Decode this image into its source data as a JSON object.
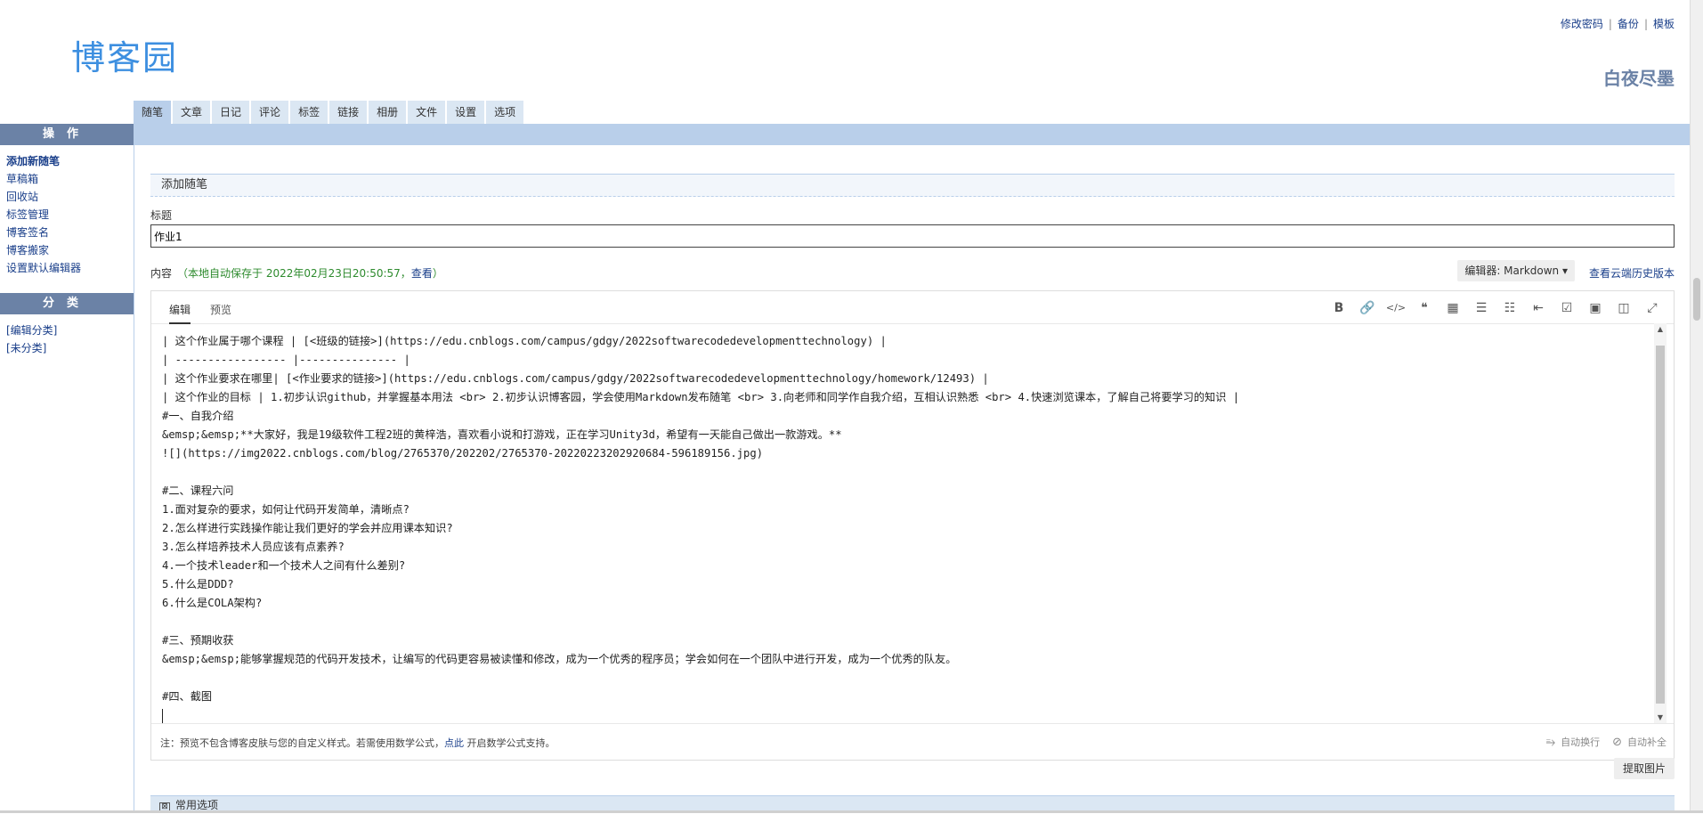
{
  "header": {
    "logo": "博客园",
    "links": [
      "修改密码",
      "备份",
      "模板"
    ],
    "user_name": "白夜尽墨"
  },
  "tabs": [
    {
      "label": "随笔",
      "active": true
    },
    {
      "label": "文章"
    },
    {
      "label": "日记"
    },
    {
      "label": "评论"
    },
    {
      "label": "标签"
    },
    {
      "label": "链接"
    },
    {
      "label": "相册"
    },
    {
      "label": "文件"
    },
    {
      "label": "设置"
    },
    {
      "label": "选项"
    }
  ],
  "sidebar": {
    "ops_title": "操作",
    "ops_items": [
      "添加新随笔",
      "草稿箱",
      "回收站",
      "标签管理",
      "博客签名",
      "博客搬家",
      "设置默认编辑器"
    ],
    "cat_title": "分类",
    "cat_items": [
      "[编辑分类]",
      "[未分类]"
    ]
  },
  "main": {
    "section_title": "添加随笔",
    "title_label": "标题",
    "title_value": "作业1",
    "content_label": "内容",
    "autosave_text": "（本地自动保存于 2022年02月23日20:50:57，",
    "autosave_link": "查看",
    "autosave_end": "）",
    "editor_select": "编辑器: Markdown ▾",
    "history_link": "查看云端历史版本",
    "editor_tabs": [
      "编辑",
      "预览"
    ],
    "toolbar_icons": [
      "B",
      "🔗",
      "</>",
      "❝",
      "▦",
      "☰",
      "☷",
      "⇤",
      "☑",
      "▣",
      "◫",
      "⤢"
    ],
    "code_lines": [
      "| 这个作业属于哪个课程 | [<班级的链接>](https://edu.cnblogs.com/campus/gdgy/2022softwarecodedevelopmenttechnology) |",
      "| ----------------- |--------------- |",
      "| 这个作业要求在哪里| [<作业要求的链接>](https://edu.cnblogs.com/campus/gdgy/2022softwarecodedevelopmenttechnology/homework/12493) |",
      "| 这个作业的目标 | 1.初步认识github，并掌握基本用法 <br> 2.初步认识博客园，学会使用Markdown发布随笔 <br> 3.向老师和同学作自我介绍，互相认识熟悉 <br> 4.快速浏览课本，了解自己将要学习的知识 |",
      "#一、自我介绍",
      "&emsp;&emsp;**大家好，我是19级软件工程2班的黄梓浩，喜欢看小说和打游戏，正在学习Unity3d，希望有一天能自己做出一款游戏。**",
      "![](https://img2022.cnblogs.com/blog/2765370/202202/2765370-20220223202920684-596189156.jpg)",
      "",
      "#二、课程六问",
      "1.面对复杂的要求，如何让代码开发简单，清晰点?",
      "2.怎么样进行实践操作能让我们更好的学会并应用课本知识?",
      "3.怎么样培养技术人员应该有点素养?",
      "4.一个技术leader和一个技术人之间有什么差别?",
      "5.什么是DDD?",
      "6.什么是COLA架构?",
      "",
      "#三、预期收获",
      "&emsp;&emsp;能够掌握规范的代码开发技术，让编写的代码更容易被读懂和修改，成为一个优秀的程序员；学会如何在一个团队中进行开发，成为一个优秀的队友。",
      "",
      "#四、截图",
      ""
    ],
    "note_prefix": "注：预览不包含博客皮肤与您的自定义样式。若需使用数学公式，",
    "note_link": "点此",
    "note_suffix": " 开启数学公式支持。",
    "footer_right": [
      "自动换行",
      "自动补全"
    ],
    "fetch_button": "提取图片",
    "common_options": "常用选项"
  }
}
